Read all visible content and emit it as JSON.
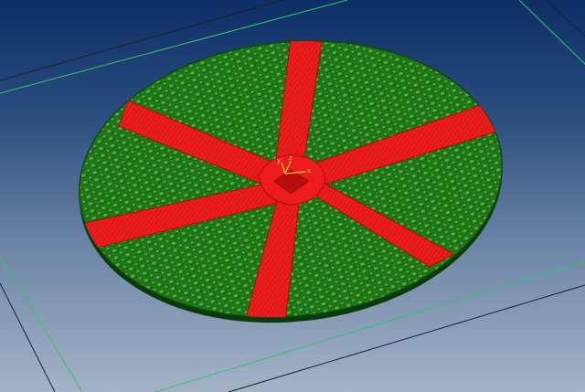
{
  "viewport": {
    "background_top": "#0d2f66",
    "background_bottom": "#a4b3c7",
    "grid_color_green": "#34c46a",
    "grid_color_dark": "#1a2230"
  },
  "model": {
    "panel_color": "#1f7d1a",
    "panel_dark": "#0f4d0e",
    "spoke_color": "#ec1c1c",
    "spoke_dark": "#8c0a0a",
    "spoke_count": 6,
    "pattern": "dimpled-panels"
  },
  "triad": {
    "x_label": "x",
    "y_label": "y",
    "z_label": "z",
    "color": "#ffd21a"
  }
}
